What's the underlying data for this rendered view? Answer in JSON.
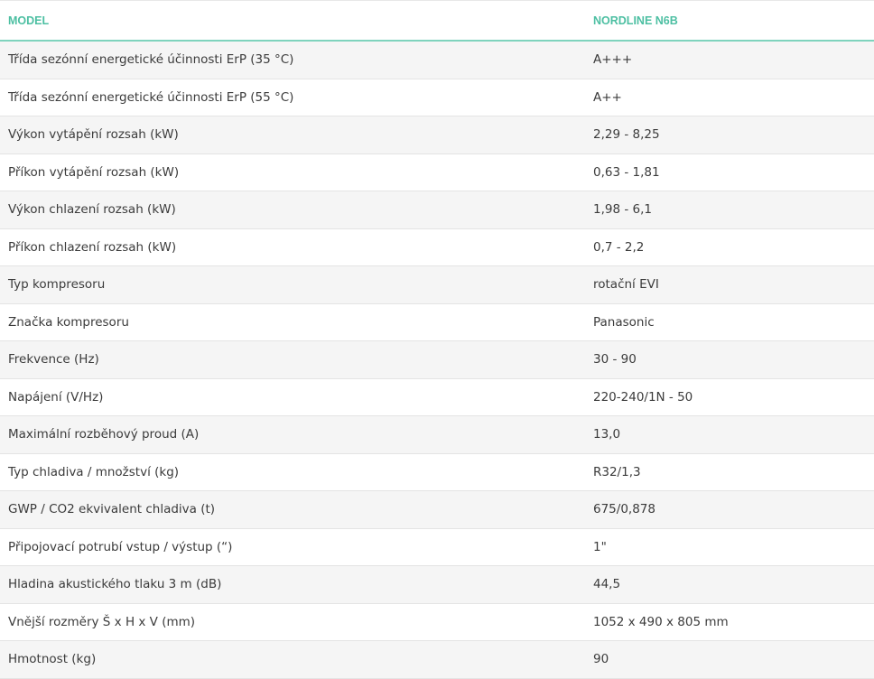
{
  "header": {
    "model_label": "MODEL",
    "product_label": "NORDLINE N6B"
  },
  "accent_color": "#4cbfa2",
  "rows": [
    {
      "label": "Třída sezónní energetické účinnosti ErP (35 °C)",
      "value": "A+++"
    },
    {
      "label": "Třída sezónní energetické účinnosti ErP (55 °C)",
      "value": "A++"
    },
    {
      "label": "Výkon vytápění rozsah (kW)",
      "value": "2,29 - 8,25"
    },
    {
      "label": "Příkon vytápění rozsah (kW)",
      "value": "0,63 - 1,81"
    },
    {
      "label": "Výkon chlazení rozsah (kW)",
      "value": "1,98 - 6,1"
    },
    {
      "label": "Příkon chlazení rozsah (kW)",
      "value": "0,7 - 2,2"
    },
    {
      "label": "Typ kompresoru",
      "value": "rotační EVI"
    },
    {
      "label": "Značka kompresoru",
      "value": "Panasonic"
    },
    {
      "label": "Frekvence (Hz)",
      "value": "30 - 90"
    },
    {
      "label": "Napájení (V/Hz)",
      "value": "220-240/1N - 50"
    },
    {
      "label": "Maximální rozběhový proud (A)",
      "value": "13,0"
    },
    {
      "label": "Typ chladiva / množství (kg)",
      "value": "R32/1,3"
    },
    {
      "label": "GWP / CO2 ekvivalent chladiva (t)",
      "value": "675/0,878"
    },
    {
      "label": "Připojovací potrubí vstup / výstup (“)",
      "value": "1\""
    },
    {
      "label": "Hladina akustického tlaku 3 m (dB)",
      "value": "44,5"
    },
    {
      "label": "Vnější rozměry Š x H x V (mm)",
      "value": "1052 x 490 x 805 mm"
    },
    {
      "label": "Hmotnost (kg)",
      "value": "90"
    }
  ]
}
